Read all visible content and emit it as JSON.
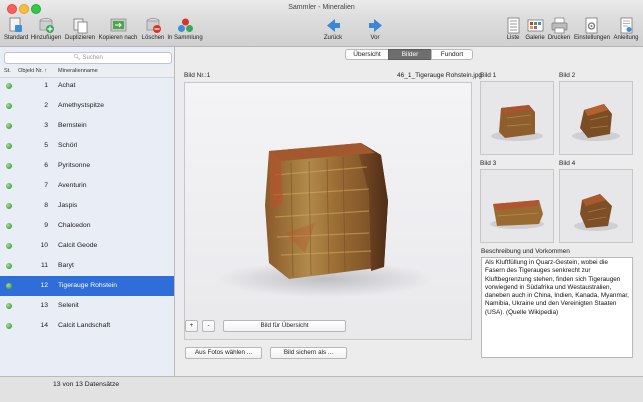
{
  "window": {
    "title": "Sammler - Mineralien"
  },
  "colors": {
    "selection": "#2f6ed8",
    "status_dot": "#3aa33a",
    "segment_active": "#6e6e6e"
  },
  "toolbar": {
    "items_left": [
      {
        "label": "Standard",
        "icon": "standard-icon"
      },
      {
        "label": "Hinzufügen",
        "icon": "add-icon"
      },
      {
        "label": "Duplizieren",
        "icon": "duplicate-icon"
      },
      {
        "label": "Kopieren nach",
        "icon": "copy-to-icon"
      },
      {
        "label": "Löschen",
        "icon": "delete-icon"
      },
      {
        "label": "In Sammlung",
        "icon": "collection-icon"
      }
    ],
    "back_label": "Zurück",
    "forward_label": "Vor",
    "items_right": [
      {
        "label": "Liste",
        "icon": "list-icon"
      },
      {
        "label": "Galerie",
        "icon": "gallery-icon"
      },
      {
        "label": "Drucken",
        "icon": "print-icon"
      },
      {
        "label": "Einstellungen",
        "icon": "settings-icon"
      },
      {
        "label": "Anleitung",
        "icon": "manual-icon"
      }
    ]
  },
  "sidebar": {
    "search_placeholder": "Suchen",
    "columns": {
      "status": "St.",
      "number": "Objekt Nr. ↑",
      "name": "Mineralienname"
    },
    "rows": [
      {
        "nr": "1",
        "name": "Achat"
      },
      {
        "nr": "2",
        "name": "Amethystspitze"
      },
      {
        "nr": "3",
        "name": "Bernstein"
      },
      {
        "nr": "5",
        "name": "Schörl"
      },
      {
        "nr": "6",
        "name": "Pyritsonne"
      },
      {
        "nr": "7",
        "name": "Aventurin"
      },
      {
        "nr": "8",
        "name": "Jaspis"
      },
      {
        "nr": "9",
        "name": "Chalcedon"
      },
      {
        "nr": "10",
        "name": "Calcit Geode"
      },
      {
        "nr": "11",
        "name": "Baryt"
      },
      {
        "nr": "12",
        "name": "Tigerauge Rohstein",
        "selected": true
      },
      {
        "nr": "13",
        "name": "Selenit"
      },
      {
        "nr": "14",
        "name": "Calcit Landschaft"
      }
    ]
  },
  "tabs": [
    "Übersicht",
    "Bilder",
    "Fundort"
  ],
  "active_tab": "Bilder",
  "image_panel": {
    "label": "Bild Nr.:1",
    "filename": "46_1_Tigerauge Rohstein.jpg",
    "plus": "+",
    "minus": "-",
    "use_for_overview": "Bild für Übersicht",
    "choose_photos": "Aus Fotos wählen ...",
    "save_image": "Bild sichern als ..."
  },
  "thumbnails": [
    "Bild 1",
    "Bild 2",
    "Bild 3",
    "Bild 4"
  ],
  "description": {
    "heading": "Beschreibung und Vorkommen",
    "text": "Als Kluftfüllung in Quarz-Gestein, wobei die Fasern des Tigerauges senkrecht zur Kluftbegrenzung stehen, finden sich Tigeraugen vorwiegend in Südafrika und Westaustralien, daneben auch in China, Indien, Kanada, Myanmar, Namibia, Ukraine und den Vereinigten Staaten (USA). (Quelle Wikipedia)"
  },
  "status": {
    "record_count": "13 von 13 Datensätze"
  }
}
